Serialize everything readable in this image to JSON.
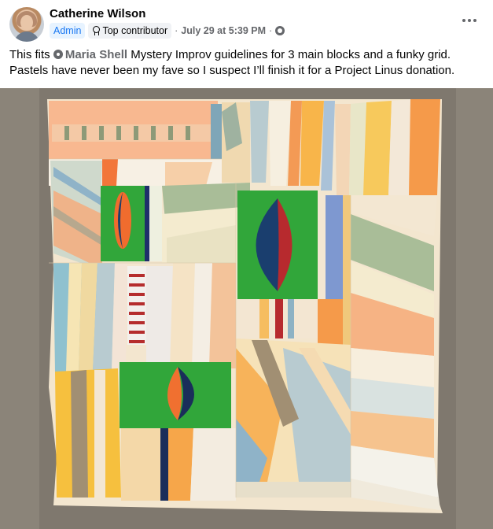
{
  "post": {
    "author": "Catherine Wilson",
    "badges": {
      "admin": "Admin",
      "contributor": "Top contributor"
    },
    "separator": "·",
    "timestamp": "July 29 at 5:39 PM",
    "audience_icon": "group-members-icon",
    "more_icon": "more-options-icon",
    "text": {
      "before": "This fits ",
      "mention": "Maria Shell",
      "after": " Mystery Improv guidelines for 3 main blocks and a funky grid. Pastels have never been my fave so I suspect I’ll finish it for a Project Linus donation."
    }
  },
  "colors": {
    "admin_badge_bg": "#e7f3ff",
    "admin_badge_text": "#1877f2",
    "secondary_text": "#65676b",
    "photo_backdrop": "#8b8479"
  }
}
